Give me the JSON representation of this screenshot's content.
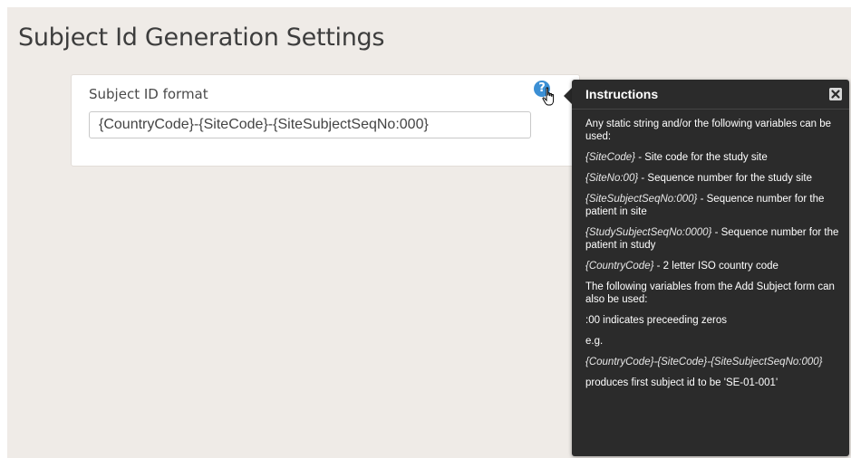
{
  "page": {
    "title": "Subject Id Generation Settings"
  },
  "form": {
    "label": "Subject ID format",
    "value": "{CountryCode}-{SiteCode}-{SiteSubjectSeqNo:000}"
  },
  "help": {
    "glyph": "?"
  },
  "tooltip": {
    "title": "Instructions",
    "intro": "Any static string and/or the following variables can be used:",
    "variables": [
      {
        "name": "{SiteCode}",
        "desc": " - Site code for the study site"
      },
      {
        "name": "{SiteNo:00}",
        "desc": " - Sequence number for the study site"
      },
      {
        "name": "{SiteSubjectSeqNo:000}",
        "desc": " - Sequence number for the patient in site"
      },
      {
        "name": "{StudySubjectSeqNo:0000}",
        "desc": " - Sequence number for the patient in study"
      },
      {
        "name": "{CountryCode}",
        "desc": " - 2 letter ISO country code"
      }
    ],
    "following": "The following variables from the Add Subject form can also be used:",
    "zeros_note": ":00 indicates preceeding zeros",
    "eg": "e.g.",
    "example": "{CountryCode}-{SiteCode}-{SiteSubjectSeqNo:000}",
    "result": "produces first subject id to be 'SE-01-001'"
  },
  "colors": {
    "background": "#efebe7",
    "tooltip_bg": "#2b2b2b",
    "help_icon": "#3b8fd4"
  }
}
